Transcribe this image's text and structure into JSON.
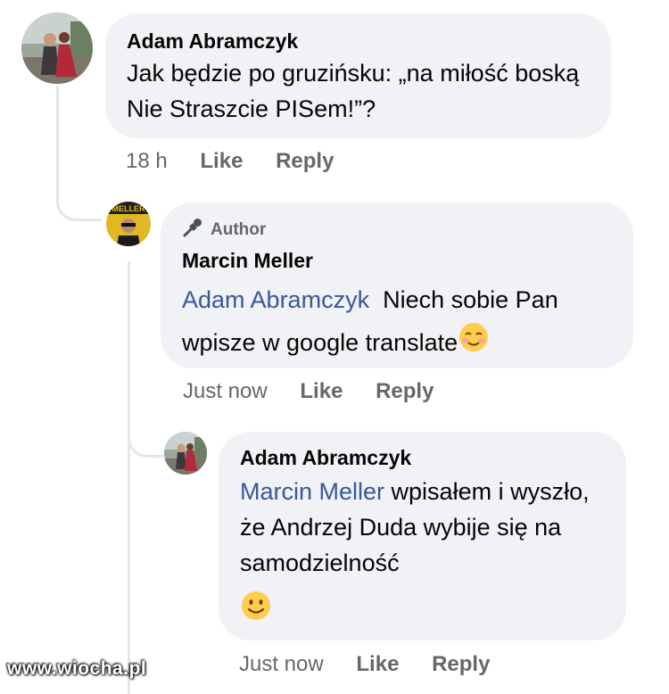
{
  "comments": [
    {
      "author": "Adam Abramczyk",
      "text": "Jak będzie po gruzińsku: „na miłość boską Nie Straszcie PISem!”?",
      "time": "18 h",
      "like": "Like",
      "reply": "Reply"
    },
    {
      "badge": "Author",
      "author": "Marcin Meller",
      "mention": "Adam Abramczyk",
      "text": "Niech sobie Pan wpisze w google translate",
      "emoji": "smiling-blushing",
      "time": "Just now",
      "like": "Like",
      "reply": "Reply"
    },
    {
      "author": "Adam Abramczyk",
      "mention": "Marcin Meller",
      "text": "wpisałem i wyszło, że Andrzej Duda wybije się na samodzielność",
      "emoji": "slightly-smiling",
      "time": "Just now",
      "like": "Like",
      "reply": "Reply"
    }
  ],
  "watermark": "www.wiocha.pl",
  "colors": {
    "bubble": "#f0f2f5",
    "mention": "#385898",
    "meta": "#65676b",
    "line": "#e4e6eb"
  }
}
